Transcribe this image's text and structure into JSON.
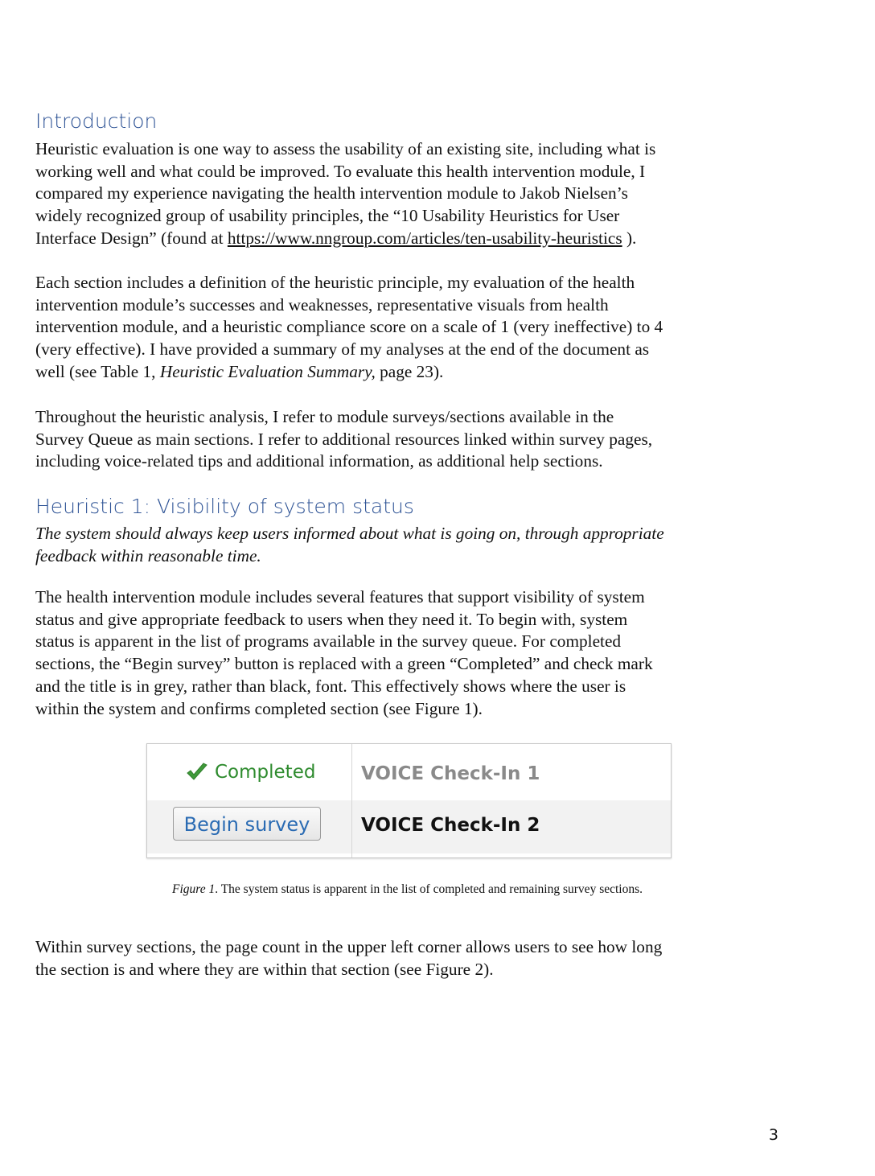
{
  "introduction": {
    "heading": "Introduction",
    "p1": {
      "l1": "Heuristic evaluation is one way to assess the usability of an existing site, including what is",
      "l2": "working well and what could be improved. To evaluate this health intervention module, I",
      "l3": "compared my experience navigating the health intervention module to Jakob Nielsen’s",
      "l4": "widely recognized group of usability principles, the “10 Usability Heuristics for User",
      "l5_before": "Interface Design” (found at ",
      "l5_link": "https://www.nngroup.com/articles/ten-usability-heuristics",
      "l5_after": " )."
    },
    "p2": {
      "l1": "Each section includes a definition of the heuristic principle, my evaluation of the health",
      "l2": "intervention module’s successes and weaknesses, representative visuals from health",
      "l3": "intervention module, and a heuristic compliance score on a scale of 1 (very ineffective) to 4",
      "l4": "(very effective). I have provided a summary of my analyses at the end of the document as",
      "l5_before": "well (see Table 1, ",
      "l5_italic": "Heuristic Evaluation Summary,",
      "l5_after": " page 23)."
    },
    "p3": {
      "l1": "Throughout the heuristic analysis, I refer to module surveys/sections available in the",
      "l2": "Survey Queue as main sections. I refer to additional resources linked within survey pages,",
      "l3": "including voice-related tips and additional information, as additional help sections."
    }
  },
  "heuristic1": {
    "heading": "Heuristic 1: Visibility of system status",
    "definition": {
      "l1": "The system should always keep users informed about what is going on, through appropriate",
      "l2": "feedback within reasonable time."
    },
    "p1": {
      "l1": "The health intervention module includes several features that support visibility of system",
      "l2": "status and give appropriate feedback to users when they need it. To begin with, system",
      "l3": "status is apparent in the list of programs available in the survey queue. For completed",
      "l4": "sections, the “Begin survey” button is replaced with a green “Completed” and check mark",
      "l5": "and the title is in grey, rather than black, font. This effectively shows where the user is",
      "l6": "within the system and confirms completed section (see Figure 1)."
    },
    "p2": {
      "l1": "Within survey sections, the page count in the upper left corner allows users to see how long",
      "l2": "the section is and where they are within that section (see Figure 2)."
    }
  },
  "figure1": {
    "rows": [
      {
        "status": "Completed",
        "title": "VOICE Check-In 1"
      },
      {
        "action": "Begin survey",
        "title": "VOICE Check-In 2"
      }
    ],
    "caption_label": "Figure 1",
    "caption_text": ". The system status is apparent in the list of completed and remaining survey sections.",
    "colors": {
      "completed_green": "#2e8b2e",
      "button_blue": "#2a6bb3",
      "completed_title_grey": "#8a8a8a"
    },
    "icons": {
      "completed": "check-mark-icon"
    }
  },
  "page_number": "3",
  "colors": {
    "heading_blue": "#2f5496"
  }
}
